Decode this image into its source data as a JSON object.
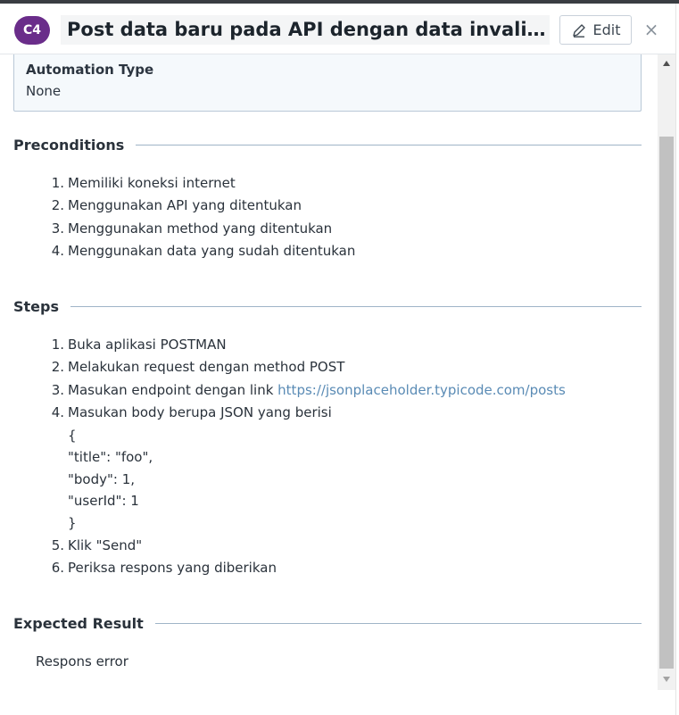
{
  "header": {
    "case_id": "C4",
    "title": "Post data baru pada API dengan data invalid pada ...",
    "edit_label": "Edit",
    "close_glyph": "×"
  },
  "fields": {
    "automation_type_label": "Automation Type",
    "automation_type_value": "None"
  },
  "preconditions": {
    "title": "Preconditions",
    "items": [
      {
        "num": "1.",
        "text": "Memiliki koneksi internet"
      },
      {
        "num": "2.",
        "text": "Menggunakan API yang ditentukan"
      },
      {
        "num": "3.",
        "text": "Menggunakan method yang ditentukan"
      },
      {
        "num": "4.",
        "text": "Menggunakan data yang sudah ditentukan"
      }
    ]
  },
  "steps": {
    "title": "Steps",
    "item1": {
      "num": "1.",
      "text": "Buka aplikasi POSTMAN"
    },
    "item2": {
      "num": "2.",
      "text": "Melakukan request dengan method POST"
    },
    "item3": {
      "num": "3.",
      "text": "Masukan endpoint dengan link ",
      "link": "https://jsonplaceholder.typicode.com/posts"
    },
    "item4": {
      "num": "4.",
      "text": "Masukan body berupa JSON yang berisi",
      "body_lines": [
        "{",
        "\"title\": \"foo\",",
        "\"body\": 1,",
        "\"userId\": 1",
        "}"
      ]
    },
    "item5": {
      "num": "5.",
      "text": "Klik \"Send\""
    },
    "item6": {
      "num": "6.",
      "text": "Periksa respons yang diberikan"
    }
  },
  "expected": {
    "title": "Expected Result",
    "text": "Respons error"
  },
  "colors": {
    "badge": "#6a2d8a",
    "link": "#5a8bb5",
    "rule": "#9fb4c7"
  }
}
